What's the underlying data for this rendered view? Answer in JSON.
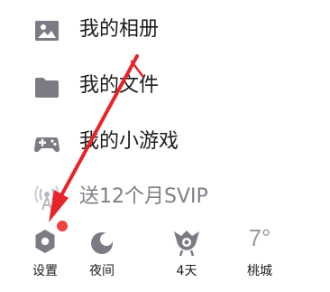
{
  "menu": {
    "items": [
      {
        "label": "我的相册",
        "icon": "photo-album-icon"
      },
      {
        "label": "我的文件",
        "icon": "folder-icon"
      },
      {
        "label": "我的小游戏",
        "icon": "gamepad-icon"
      },
      {
        "label": "送12个月SVIP",
        "icon": "broadcast-icon"
      }
    ]
  },
  "bottom_bar": {
    "settings": {
      "label": "设置",
      "icon": "settings-icon"
    },
    "night": {
      "label": "夜间",
      "icon": "night-mode-icon"
    },
    "checkin": {
      "label": "4天",
      "icon": "checkin-days-icon"
    },
    "weather": {
      "label": "桃城",
      "temperature": "7°",
      "icon": "weather-icon"
    }
  },
  "annotation": {
    "type": "red-arrow",
    "color": "#e8232a"
  },
  "colors": {
    "icon": "#7b7b84",
    "badge": "#f0443f",
    "text": "#1d1d1f",
    "muted": "#9a9aa2"
  }
}
